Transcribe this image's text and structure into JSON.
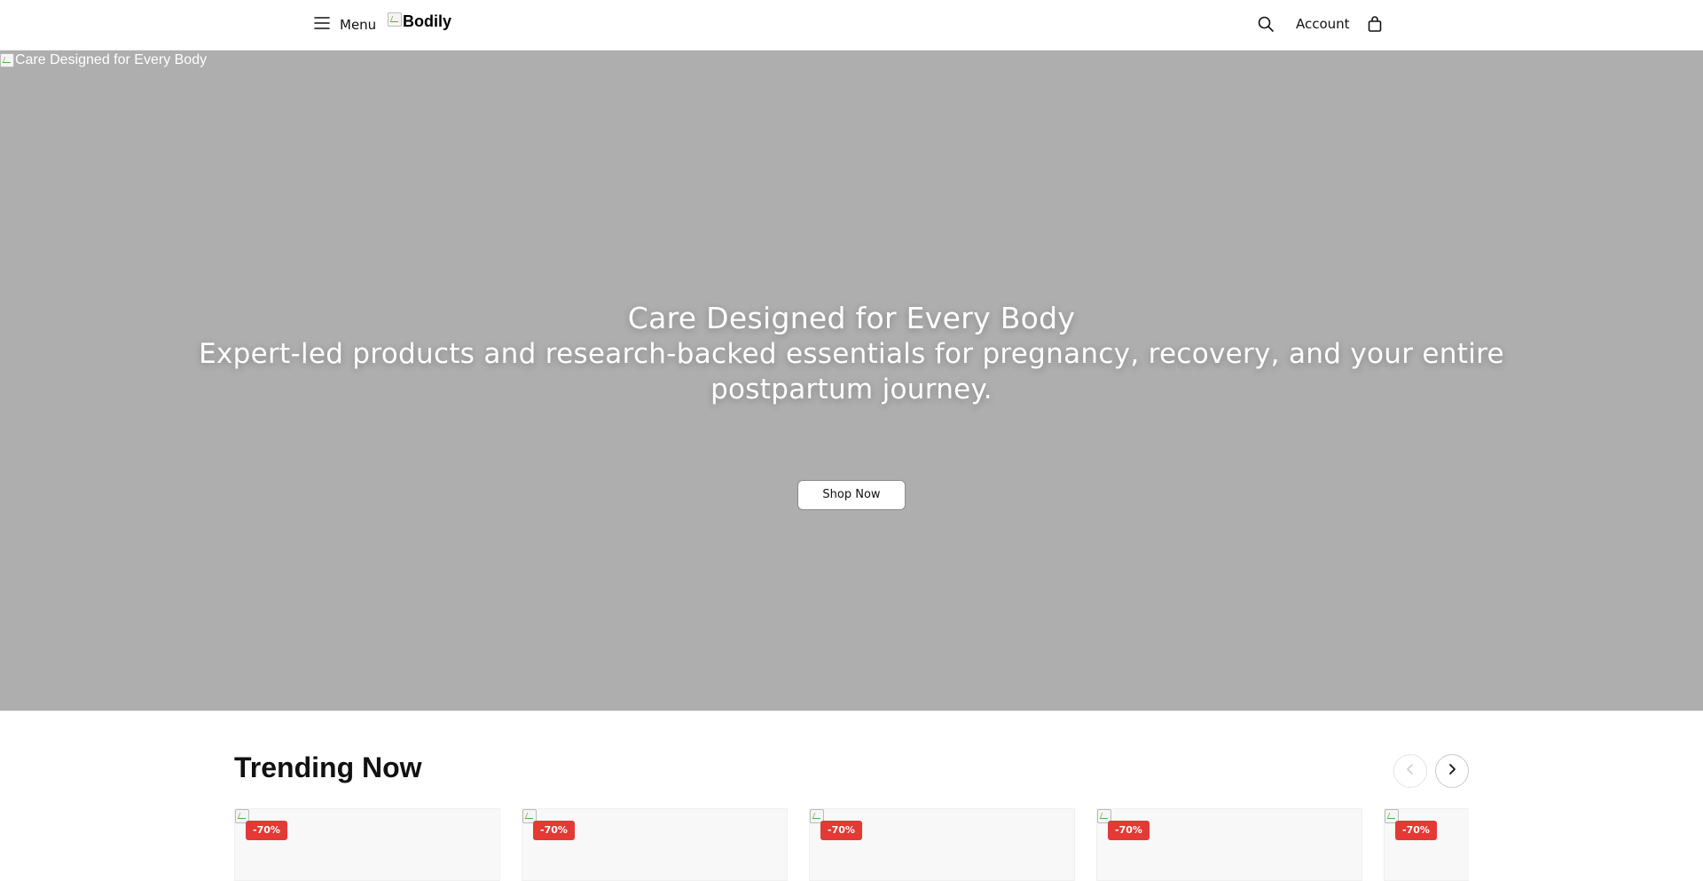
{
  "header": {
    "menu_label": "Menu",
    "logo_alt": "Bodily",
    "account_label": "Account"
  },
  "hero": {
    "image_alt": "Care Designed for Every Body",
    "title": "Care Designed for Every Body",
    "subtitle": "Expert-led products and research-backed essentials for pregnancy, recovery, and your entire postpartum journey.",
    "cta_label": "Shop Now",
    "background_color": "#aeaeae"
  },
  "trending": {
    "title": "Trending Now",
    "products": [
      {
        "badge": "-70%"
      },
      {
        "badge": "-70%"
      },
      {
        "badge": "-70%"
      },
      {
        "badge": "-70%"
      },
      {
        "badge": "-70%"
      }
    ]
  },
  "colors": {
    "badge": "#e53935",
    "text": "#111111"
  },
  "icons": [
    "hamburger-icon",
    "search-icon",
    "shopping-bag-icon",
    "chevron-left-icon",
    "chevron-right-icon"
  ]
}
